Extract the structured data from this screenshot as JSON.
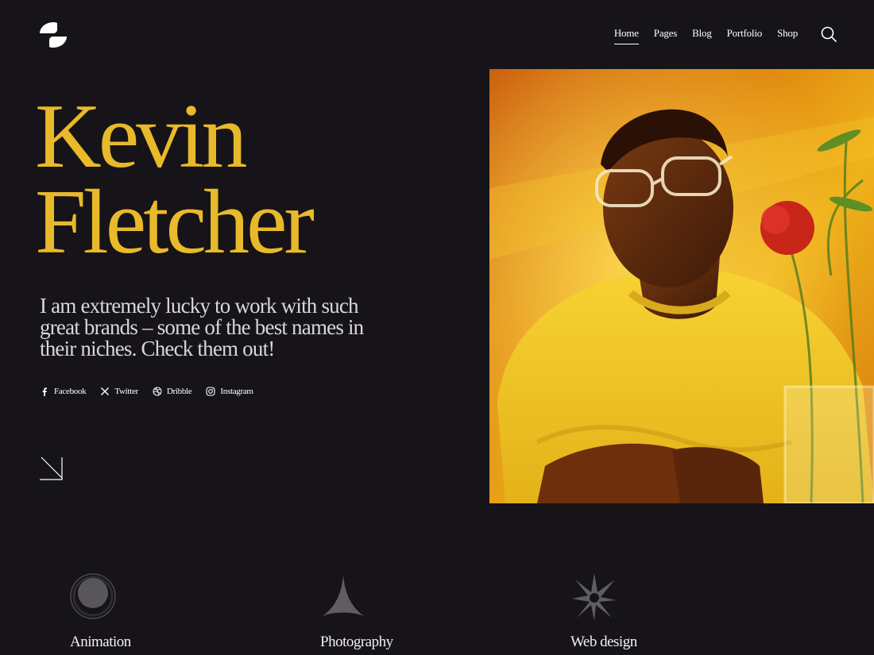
{
  "header": {
    "logo": "brand-logo",
    "nav": [
      {
        "label": "Home",
        "active": true
      },
      {
        "label": "Pages"
      },
      {
        "label": "Blog"
      },
      {
        "label": "Portfolio"
      },
      {
        "label": "Shop"
      }
    ],
    "search_icon": "search-icon"
  },
  "hero": {
    "first_name": "Kevin",
    "last_name": "Fletcher",
    "tagline": "I am extremely lucky to work with such great brands – some of the best names in their niches. Check them out!",
    "accent_color": "#e8b92a",
    "socials": [
      {
        "label": "Facebook",
        "icon": "facebook-icon"
      },
      {
        "label": "Twitter",
        "icon": "x-icon"
      },
      {
        "label": "Dribble",
        "icon": "dribbble-icon"
      },
      {
        "label": "Instagram",
        "icon": "instagram-icon"
      }
    ],
    "scroll_icon": "arrow-down-right-icon",
    "photo": "portrait-photo"
  },
  "services": [
    {
      "label": "Animation",
      "icon": "circle-icon"
    },
    {
      "label": "Photography",
      "icon": "cone-icon"
    },
    {
      "label": "Web design",
      "icon": "star-burst-icon"
    }
  ]
}
